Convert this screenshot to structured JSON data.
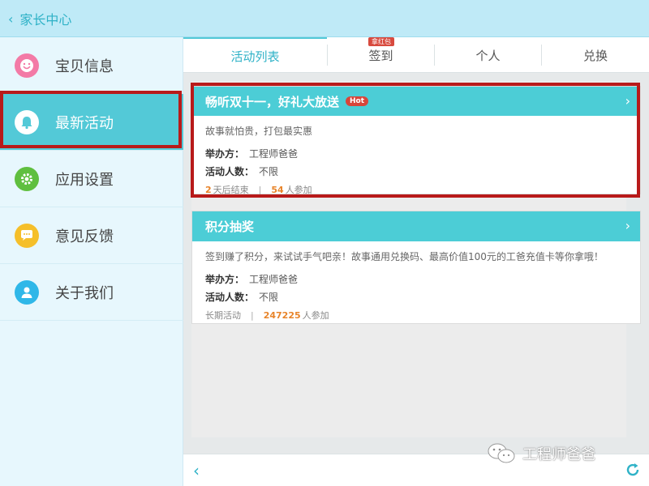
{
  "header": {
    "back_label": "家长中心"
  },
  "sidebar": {
    "items": [
      {
        "label": "宝贝信息",
        "icon": "face-icon",
        "color": "#f37aa6"
      },
      {
        "label": "最新活动",
        "icon": "bell-icon",
        "color": "#ffffff"
      },
      {
        "label": "应用设置",
        "icon": "gear-icon",
        "color": "#5fbf3f"
      },
      {
        "label": "意见反馈",
        "icon": "chat-icon",
        "color": "#f5bf2a"
      },
      {
        "label": "关于我们",
        "icon": "person-icon",
        "color": "#2fb7e8"
      }
    ]
  },
  "tabs": [
    {
      "label": "活动列表"
    },
    {
      "label": "签到",
      "badge": "拿红包"
    },
    {
      "label": "个人"
    },
    {
      "label": "兑换"
    }
  ],
  "cards": [
    {
      "title": "畅听双十一，好礼大放送",
      "hot": "Hot",
      "desc": "故事就怕贵，打包最实惠",
      "organizer_label": "举办方：",
      "organizer": "工程师爸爸",
      "participants_label": "活动人数：",
      "participants": "不限",
      "time_num": "2",
      "time_text": "天后结束",
      "join_num": "54",
      "join_text": "人参加"
    },
    {
      "title": "积分抽奖",
      "desc": "签到赚了积分，来试试手气吧亲！故事通用兑换码、最高价值100元的工爸充值卡等你拿哦！",
      "organizer_label": "举办方：",
      "organizer": "工程师爸爸",
      "participants_label": "活动人数：",
      "participants": "不限",
      "time_text": "长期活动",
      "join_num": "247225",
      "join_text": "人参加"
    }
  ],
  "watermark": "工程师爸爸",
  "colors": {
    "accent": "#4ccdd6",
    "highlight": "#b81a1a",
    "number": "#e8842a"
  }
}
